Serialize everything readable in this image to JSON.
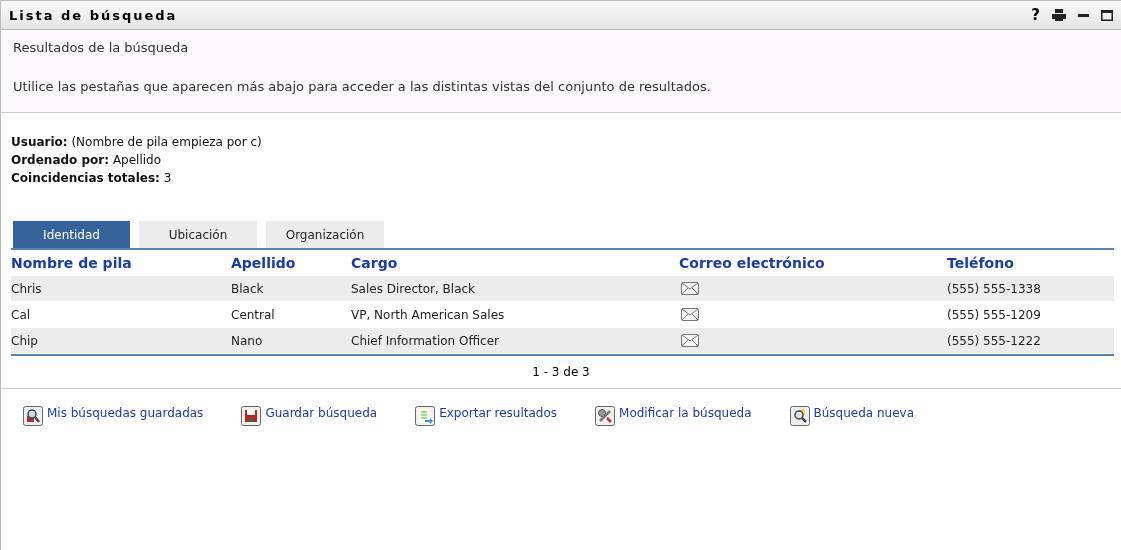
{
  "window": {
    "title": "Lista de búsqueda",
    "help": "?"
  },
  "intro": {
    "heading": "Resultados de la búsqueda",
    "text": "Utilice las pestañas que aparecen más abajo para acceder a las distintas vistas del conjunto de resultados."
  },
  "criteria": [
    "**Usuario:** (Nombre de pila empieza por c)",
    "**Ordenado por:** Apellido",
    "**Coincidencias totales:** 3"
  ],
  "tabs": [
    {
      "label": "Identidad",
      "selected": true
    },
    {
      "label": "Ubicación",
      "selected": false
    },
    {
      "label": "Organización",
      "selected": false
    }
  ],
  "table": {
    "columns": [
      "Nombre de pila",
      "Apellido",
      "Cargo",
      "Correo electrónico",
      "Teléfono"
    ],
    "rows": [
      {
        "first": "Chris",
        "last": "Black",
        "title": "Sales Director, Black",
        "phone": "(555) 555-1338"
      },
      {
        "first": "Cal",
        "last": "Central",
        "title": "VP, North American Sales",
        "phone": "(555) 555-1209"
      },
      {
        "first": "Chip",
        "last": "Nano",
        "title": "Chief Information Officer",
        "phone": "(555) 555-1222"
      }
    ]
  },
  "pagination": "1 - 3 de 3",
  "actions": [
    {
      "kind": "saved",
      "label": "Mis búsquedas guardadas"
    },
    {
      "kind": "save",
      "label": "Guardar búsqueda"
    },
    {
      "kind": "export",
      "label": "Exportar resultados"
    },
    {
      "kind": "modify",
      "label": "Modificar la búsqueda"
    },
    {
      "kind": "new",
      "label": "Búsqueda nueva"
    }
  ]
}
